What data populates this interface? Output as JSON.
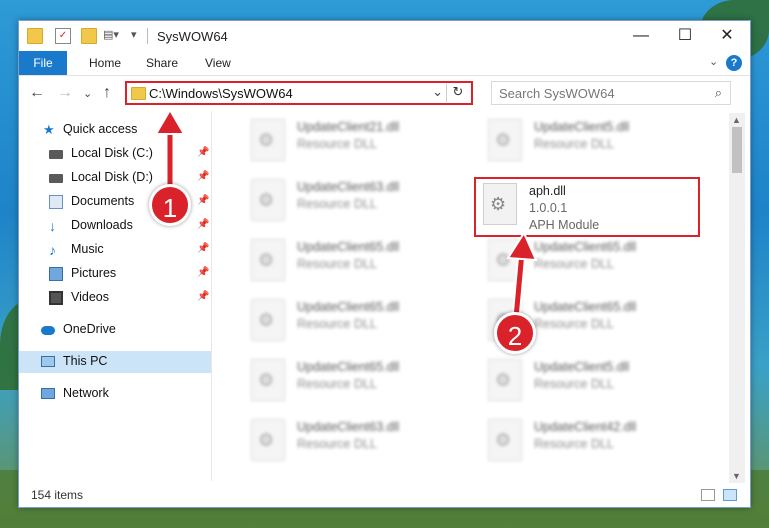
{
  "window": {
    "title": "SysWOW64",
    "controls": {
      "minimize": "—",
      "maximize": "☐",
      "close": "✕"
    }
  },
  "ribbon": {
    "tabs": [
      "File",
      "Home",
      "Share",
      "View"
    ],
    "help": "?"
  },
  "navigation": {
    "address": "C:\\Windows\\SysWOW64",
    "search_placeholder": "Search SysWOW64"
  },
  "sidebar": {
    "items": [
      {
        "label": "Quick access",
        "icon": "star-icon"
      },
      {
        "label": "Local Disk (C:)",
        "icon": "drive-icon"
      },
      {
        "label": "Local Disk (D:)",
        "icon": "drive-icon"
      },
      {
        "label": "Documents",
        "icon": "documents-icon"
      },
      {
        "label": "Downloads",
        "icon": "download-icon"
      },
      {
        "label": "Music",
        "icon": "music-icon"
      },
      {
        "label": "Pictures",
        "icon": "pictures-icon"
      },
      {
        "label": "Videos",
        "icon": "videos-icon"
      },
      {
        "label": "OneDrive",
        "icon": "cloud-icon"
      },
      {
        "label": "This PC",
        "icon": "computer-icon"
      },
      {
        "label": "Network",
        "icon": "network-icon"
      }
    ]
  },
  "files": [
    {
      "name": "UpdateClient21.dll",
      "type": "Resource DLL"
    },
    {
      "name": "UpdateClient5.dll",
      "type": "Resource DLL"
    },
    {
      "name": "UpdateClient63.dll",
      "type": "Resource DLL"
    },
    {
      "name": "aph.dll",
      "version": "1.0.0.1",
      "type": "APH Module"
    },
    {
      "name": "UpdateClient65.dll",
      "type": "Resource DLL"
    },
    {
      "name": "UpdateClient65.dll",
      "type": "Resource DLL"
    },
    {
      "name": "UpdateClient65.dll",
      "type": "Resource DLL"
    },
    {
      "name": "UpdateClient65.dll",
      "type": "Resource DLL"
    },
    {
      "name": "UpdateClient65.dll",
      "type": "Resource DLL"
    },
    {
      "name": "UpdateClient5.dll",
      "type": "Resource DLL"
    },
    {
      "name": "UpdateClient63.dll",
      "type": "Resource DLL"
    },
    {
      "name": "UpdateClient42.dll",
      "type": "Resource DLL"
    }
  ],
  "status": {
    "count": "154 items"
  },
  "annotations": {
    "step1": "1",
    "step2": "2",
    "color": "#d9222a"
  }
}
